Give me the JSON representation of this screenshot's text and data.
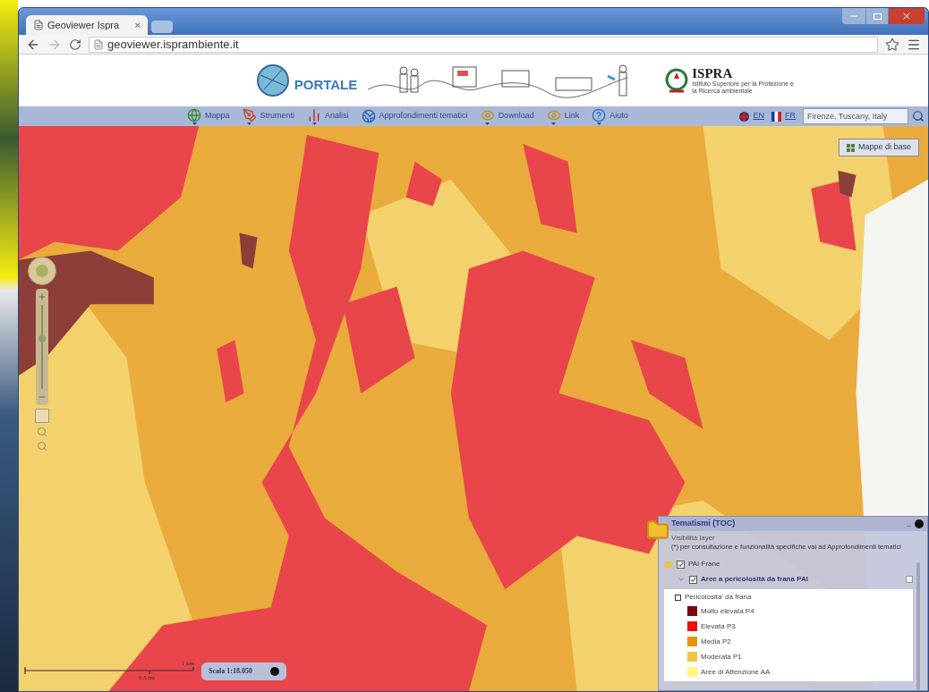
{
  "browser": {
    "tab_title": "Geoviewer Ispra",
    "tab_close": "×",
    "url": "geoviewer.isprambiente.it"
  },
  "header": {
    "logo_text": "PORTALE",
    "ispra_name": "ISPRA",
    "ispra_subtitle": "Istituto Superiore per la Protezione e la Ricerca ambientale"
  },
  "nav": [
    {
      "label": "Mappa",
      "kind": "globe",
      "dropdown": true
    },
    {
      "label": "Strumenti",
      "kind": "tools",
      "dropdown": true
    },
    {
      "label": "Analisi",
      "kind": "chart",
      "dropdown": true
    },
    {
      "label": "Approfondimenti tematici",
      "kind": "earth",
      "dropdown": false
    },
    {
      "label": "Download",
      "kind": "eye",
      "dropdown": true
    },
    {
      "label": "Link",
      "kind": "eye",
      "dropdown": true
    },
    {
      "label": "Aiuto",
      "kind": "help",
      "dropdown": true
    }
  ],
  "languages": [
    {
      "code": "EN",
      "kind": "uk"
    },
    {
      "code": "FR",
      "kind": "fr"
    }
  ],
  "search": {
    "value": "Firenze, Tuscany, Italy"
  },
  "map": {
    "zoom_level": {
      "level": 0.6
    },
    "basemap_button": "Mappe di base",
    "scale_km": "1 km",
    "scale_mi": "0.5 mi",
    "scale_label": "Scala 1:18.050"
  },
  "toc": {
    "title": "Tematismi (TOC)",
    "minimize": "_",
    "subtitle": "Visibilità layer",
    "note": "(*) per consultazione e funzionalità specifiche vai ad Approfondimenti tematici",
    "layer": {
      "label": "PAI Frane",
      "checked": true
    },
    "sublayer": {
      "label": "Aree a pericolosità da frana PAI",
      "checked": true,
      "expanded": true
    },
    "group": "Pericolosita' da frana",
    "classes": [
      {
        "label": "Molto elevata P4",
        "color": "#7a0a0a"
      },
      {
        "label": "Elevata P3",
        "color": "#e81010"
      },
      {
        "label": "Media P2",
        "color": "#e0960a"
      },
      {
        "label": "Moderata P1",
        "color": "#f2c440"
      },
      {
        "label": "Aree di Attenzione AA",
        "color": "#fff880"
      }
    ]
  }
}
